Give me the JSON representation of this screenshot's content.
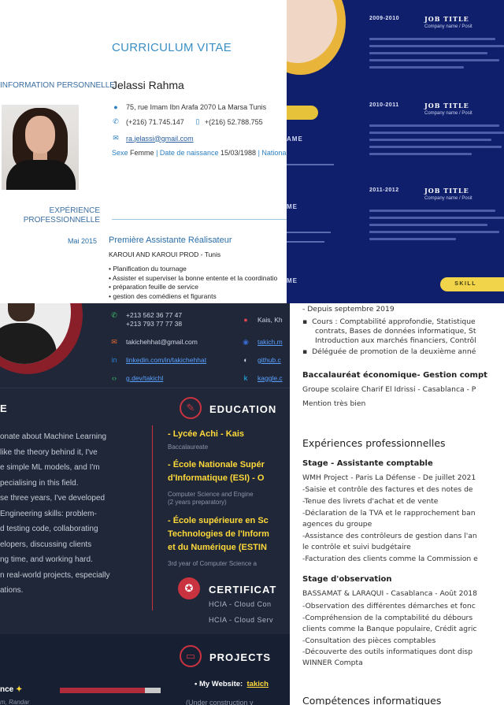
{
  "top_left": {
    "title": "CURRICULUM VITAE",
    "section_personal": "INFORMATION PERSONNELLE",
    "name": "Jelassi Rahma",
    "address": "75, rue Imam  Ibn Arafa  2070 La Marsa Tunis",
    "phone1": "(+216) 71.745.147",
    "phone2": "+(216) 52.788.755",
    "email": "ra.jelassi@gmail.com",
    "sex_label": "Sexe",
    "sex_value": "Femme",
    "dob_label": "Date de naissance",
    "dob_value": "15/03/1988",
    "nat_label": "Nationali",
    "section_exp_1": "EXPÉRIENCE",
    "section_exp_2": "PROFESSIONNELLE",
    "job_date": "Mai 2015",
    "job_title": "Première  Assistante Réalisateur",
    "company": "KAROUI AND KAROUI PROD - Tunis",
    "bullets": [
      "Planification du tournage",
      "Assister et superviser la bonne entente et la coordinatio",
      "préparation feuille de service",
      "gestion des comédiens et figurants"
    ]
  },
  "top_right": {
    "side_labels": [
      "AME",
      "ME",
      "ME",
      "ME"
    ],
    "entries": [
      {
        "years": "2009-2010",
        "title": "JOB TITLE",
        "company": "Company name / Posit"
      },
      {
        "years": "2010-2011",
        "title": "JOB TITLE",
        "company": "Company name / Posit"
      },
      {
        "years": "2011-2012",
        "title": "JOB TITLE",
        "company": "Company name / Posit"
      }
    ],
    "skills_label": "SKILL"
  },
  "bottom_left": {
    "phones": "+213 562 36 77 47\n+213 793 77 77 38",
    "location": "Kais, Kh",
    "email": "takichehhat@gmail.com",
    "site": "takich.m",
    "linkedin": "linkedin.com/in/takichehhat",
    "github": "github.c",
    "devpage": "g.dev/takichl",
    "kaggle": "kaggle.c",
    "about_heading": "E",
    "about_lines": [
      "onate about Machine Learning",
      "like the theory behind it,  I've",
      "e simple ML models, and I'm",
      "pecialising in this field.",
      "se three years, I've developed",
      "Engineering  skills:  problem-",
      "d  testing  code,  collaborating",
      "elopers,    discussing    clients",
      "ng time, and working hard.",
      "n real-world projects, especially",
      "ations."
    ],
    "education_heading": "EDUCATION",
    "edu": [
      {
        "title": "- Lycée Achi - Kais",
        "sub": "Baccalaureate"
      },
      {
        "title": "- École Nationale Supér",
        "title2": "d'Informatique (ESI) - O",
        "sub": "Computer Science and Engine",
        "sub2": "(2 years preparatory)"
      },
      {
        "title": "- École supérieure en Sc",
        "title2": "Technologies de l'Inform",
        "title3": "et du Numérique (ESTIN",
        "sub": "3rd year of Computer Science a"
      }
    ],
    "cert_heading": "CERTIFICAT",
    "certs": [
      "HCIA - Cloud Con",
      "HCIA - Cloud Serv"
    ],
    "projects_heading": "PROJECTS",
    "project_label": "• My Website:",
    "project_link": "takich",
    "project_status": "(Under construction v",
    "exp_title": "nce",
    "exp_sub": "m, Randar"
  },
  "bottom_right": {
    "lines": [
      {
        "text": "- Depuis septembre 2019",
        "style": "normal"
      },
      {
        "text": "Cours : Comptabilité approfondie, Statistique",
        "style": "square"
      },
      {
        "text": "contrats, Bases de données informatique, St",
        "style": "indent"
      },
      {
        "text": "Introduction aux marchés financiers, Contrôl",
        "style": "indent"
      },
      {
        "text": "Déléguée de promotion de la deuxième anné",
        "style": "square"
      },
      {
        "text": "Baccalauréat économique- Gestion compt",
        "style": "bold"
      },
      {
        "text": "Groupe scolaire Charif El Idrissi - Casablanca - P",
        "style": "normal"
      },
      {
        "text": "Mention très bien",
        "style": "normal"
      }
    ],
    "section_exp": "Expériences professionnelles",
    "job1_title": "Stage - Assistante comptable",
    "job1_lines": [
      "WMH Project - Paris La Défense - De juillet 2021",
      "-Saisie et contrôle des factures et des notes de",
      "-Tenue des livrets d'achat et de vente",
      "-Déclaration de la TVA et le rapprochement ban",
      "agences du groupe",
      "-Assistance des contrôleurs de gestion dans l'an",
      "le contrôle et suivi budgétaire",
      "-Facturation des clients comme la Commission e"
    ],
    "job2_title": "Stage d'observation",
    "job2_lines": [
      "BASSAMAT & LARAQUI - Casablanca - Août 2018",
      "-Observation des différentes démarches et fonc",
      "-Compréhension de la comptabilité du débours",
      "clients comme la Banque populaire, Crédit agric",
      "-Consultation des pièces comptables",
      "-Découverte des outils informatiques dont disp",
      "WINNER Compta"
    ],
    "section_it": "Compétences informatiques"
  }
}
